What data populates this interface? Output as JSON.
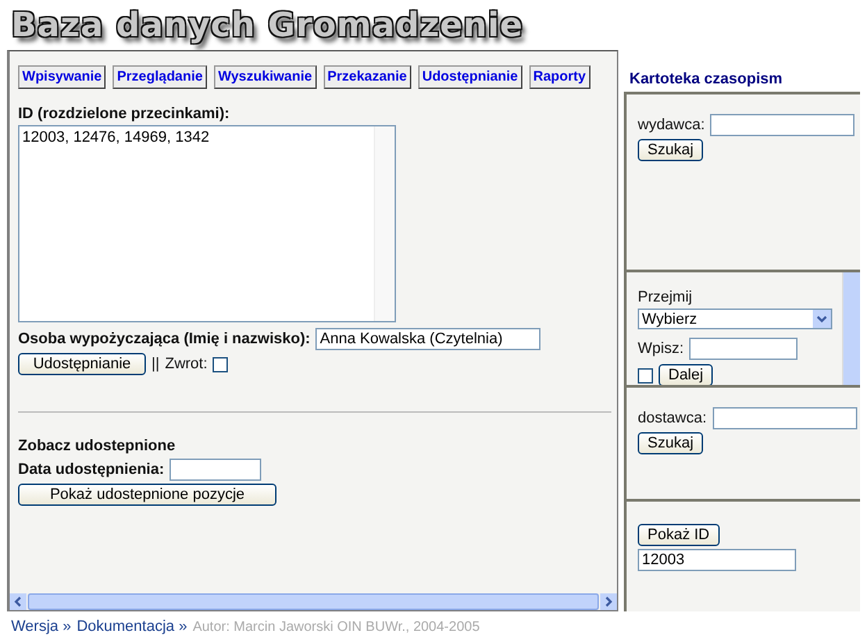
{
  "header": {
    "title": "Baza danych Gromadzenie"
  },
  "tabs": [
    {
      "label": "Wpisywanie"
    },
    {
      "label": "Przeglądanie"
    },
    {
      "label": "Wyszukiwanie"
    },
    {
      "label": "Przekazanie"
    },
    {
      "label": "Udostępnianie"
    },
    {
      "label": "Raporty"
    }
  ],
  "ids": {
    "label": "ID (rozdzielone przecinkami):",
    "value": "12003, 12476, 14969, 1342"
  },
  "borrower": {
    "label": "Osoba wypożyczająca (Imię i nazwisko):",
    "value": "Anna Kowalska (Czytelnia)"
  },
  "lend_button": "Udostępnianie",
  "return": {
    "separator": "||",
    "label": "Zwrot:",
    "checked": false
  },
  "shared": {
    "heading": "Zobacz udostepnione",
    "date_label": "Data udostępnienia:",
    "button": "Pokaż udostepnione pozycje"
  },
  "sidebar": {
    "title": "Kartoteka czasopism",
    "publisher": {
      "label": "wydawca:",
      "button": "Szukaj"
    },
    "take_over": {
      "label": "Przejmij",
      "select": "Wybierz",
      "input_label": "Wpisz:",
      "next_button": "Dalej",
      "checked": false
    },
    "supplier": {
      "label": "dostawca:",
      "button": "Szukaj"
    },
    "show_id": {
      "button": "Pokaż ID",
      "value": "12003"
    }
  },
  "footer": {
    "links": [
      "Wersja »",
      "Dokumentacja »"
    ],
    "author": "Autor: Marcin Jaworski OIN BUWr., 2004-2005"
  }
}
